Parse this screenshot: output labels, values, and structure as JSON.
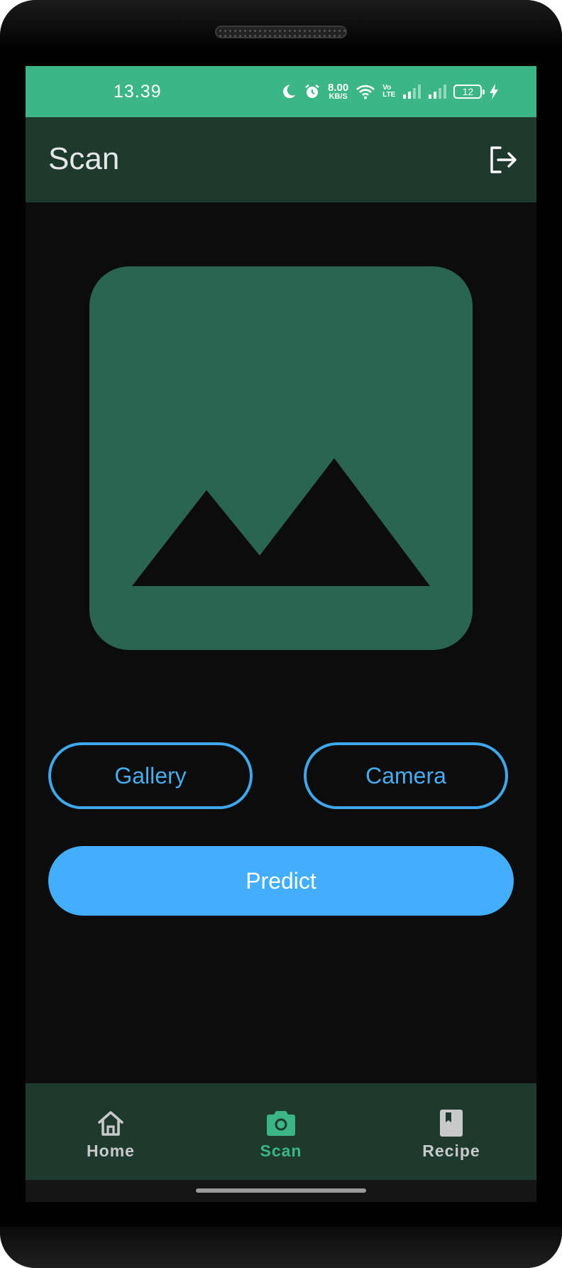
{
  "status_bar": {
    "time": "13.39",
    "net_speed_value": "8.00",
    "net_speed_unit": "KB/S",
    "volte_top": "Vo",
    "volte_bottom": "LTE",
    "battery_level": "12",
    "icons": [
      "moon-icon",
      "alarm-icon",
      "wifi-icon",
      "volte-icon",
      "signal-icon",
      "signal-icon",
      "battery-icon",
      "charging-icon"
    ]
  },
  "app_bar": {
    "title": "Scan",
    "action_icon": "logout-icon"
  },
  "image_placeholder": {
    "icon": "image-placeholder-icon"
  },
  "buttons": {
    "gallery": "Gallery",
    "camera": "Camera",
    "predict": "Predict"
  },
  "bottom_nav": {
    "items": [
      {
        "label": "Home",
        "icon": "home-icon",
        "active": false
      },
      {
        "label": "Scan",
        "icon": "camera-icon",
        "active": true
      },
      {
        "label": "Recipe",
        "icon": "book-icon",
        "active": false
      }
    ]
  },
  "colors": {
    "status_bar": "#3cb587",
    "app_bar": "#1e3a2f",
    "background": "#0d0c0c",
    "placeholder": "#296550",
    "accent_blue": "#42aefc",
    "active_nav": "#3cb587",
    "inactive_nav": "#c9c9c9"
  }
}
